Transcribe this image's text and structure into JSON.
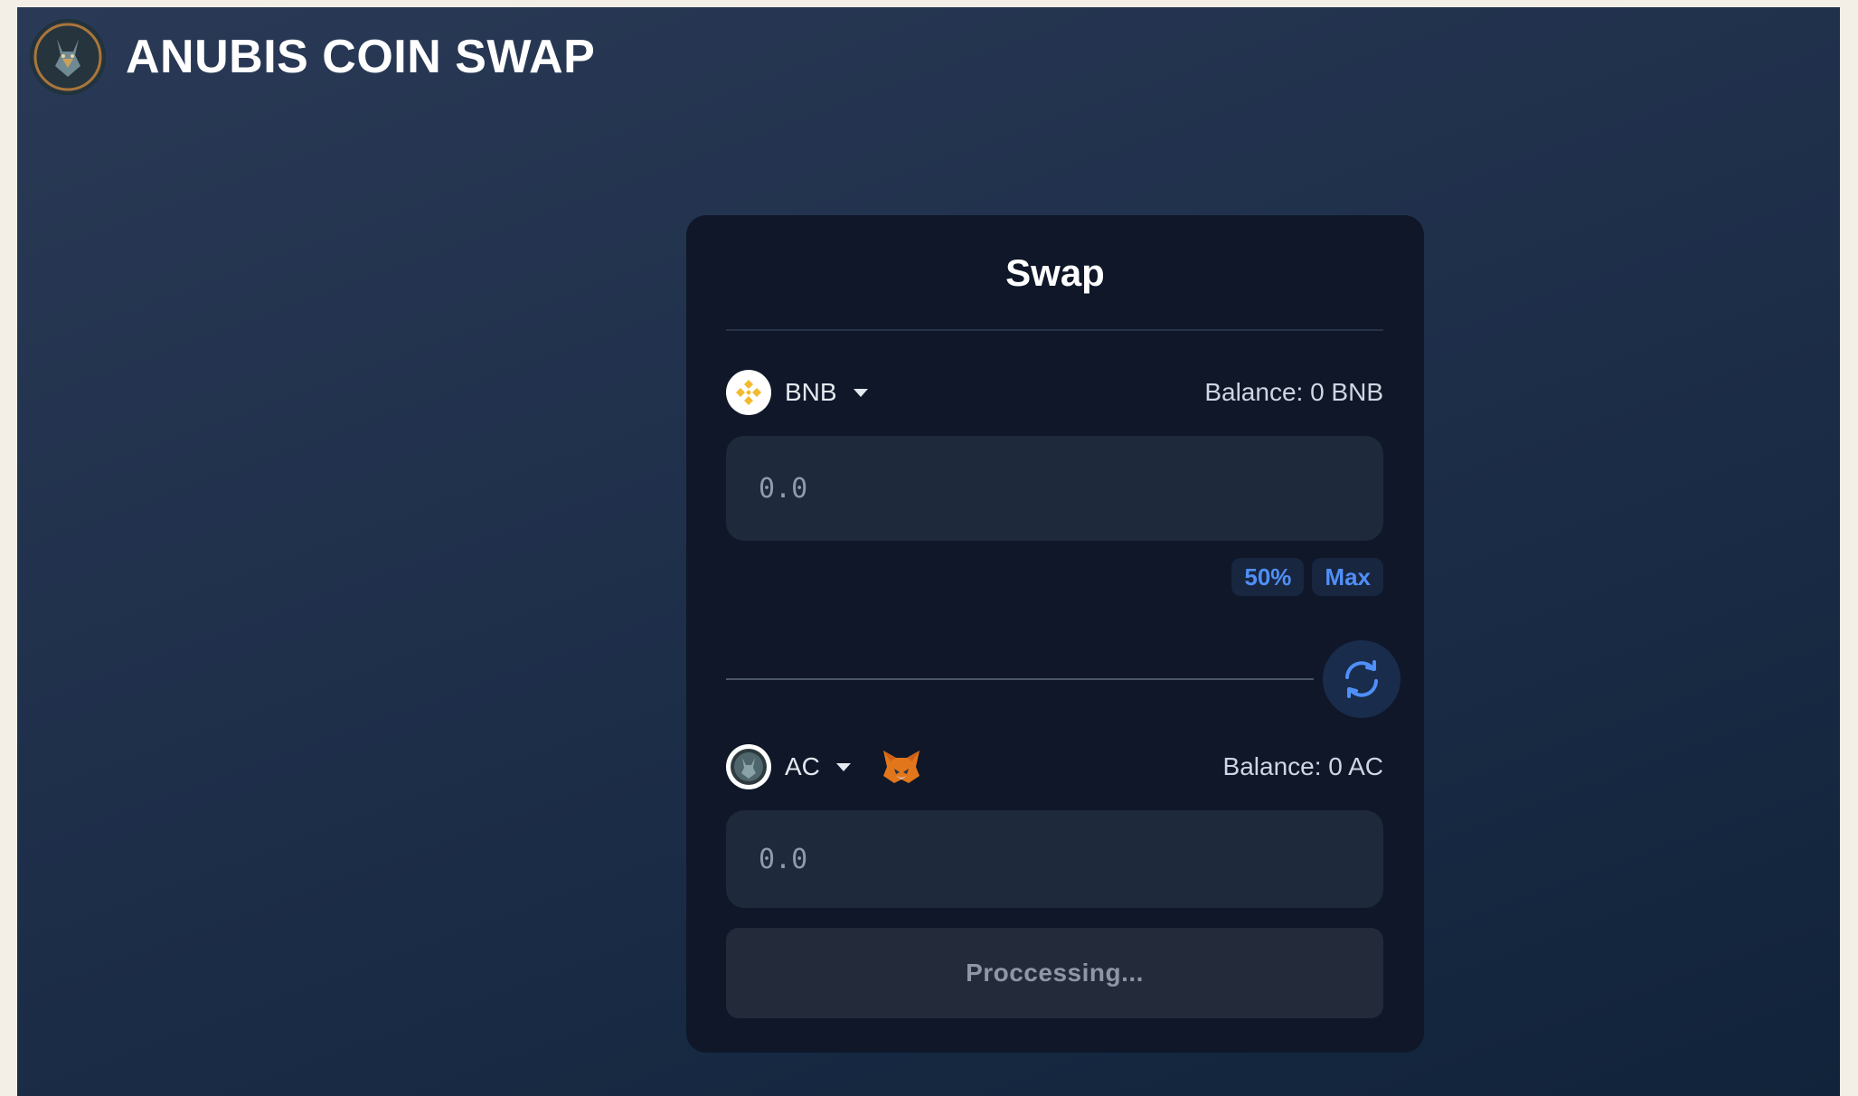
{
  "app": {
    "title": "ANUBIS COIN SWAP",
    "logo_icon": "anubis-coin-logo"
  },
  "swap": {
    "title": "Swap",
    "from": {
      "symbol": "BNB",
      "icon": "bnb-icon",
      "balance_text": "Balance: 0 BNB",
      "placeholder": "0.0",
      "value": ""
    },
    "percent_buttons": [
      "50%",
      "Max"
    ],
    "switch_icon": "swap-arrows-icon",
    "to": {
      "symbol": "AC",
      "icon": "anubis-coin-icon",
      "wallet_icon": "metamask-fox-icon",
      "balance_text": "Balance: 0 AC",
      "placeholder": "0.0",
      "value": ""
    },
    "submit_label": "Proccessing..."
  },
  "colors": {
    "card_bg": "#0f1729",
    "input_bg": "#1f293c",
    "accent_blue": "#4f8ff7",
    "bnb_yellow": "#f3ba2f",
    "fox_orange": "#e2761b"
  }
}
